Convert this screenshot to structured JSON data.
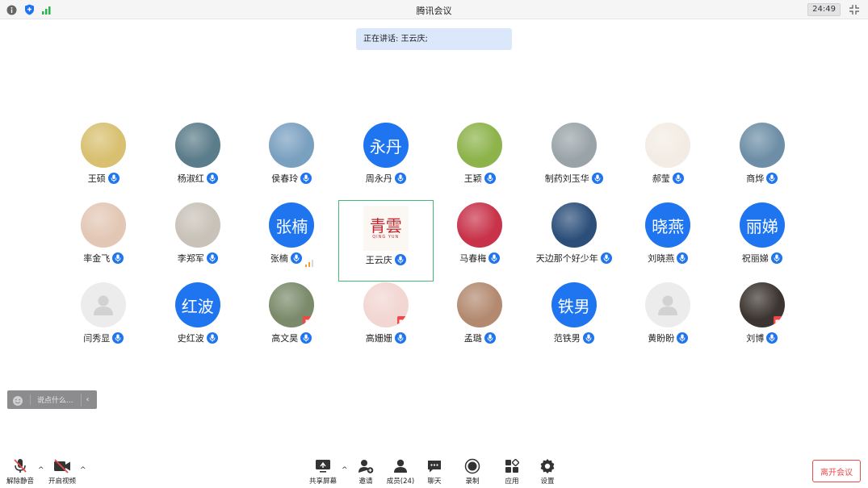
{
  "window": {
    "title": "腾讯会议",
    "timer": "24:49"
  },
  "banner": {
    "speaking": "正在讲话: 王云庆;"
  },
  "participants": [
    {
      "name": "王硕",
      "avatar": "photo",
      "color": "#d8c070"
    },
    {
      "name": "杨淑红",
      "avatar": "photo",
      "color": "#5b7c8a"
    },
    {
      "name": "侯春玲",
      "avatar": "photo",
      "color": "#7aa0c0"
    },
    {
      "name": "周永丹",
      "avatar": "text",
      "text": "永丹"
    },
    {
      "name": "王颖",
      "avatar": "photo",
      "color": "#8db34a"
    },
    {
      "name": "制药刘玉华",
      "avatar": "photo",
      "color": "#9aa4a8"
    },
    {
      "name": "郝莹",
      "avatar": "photo",
      "color": "#f3ece4"
    },
    {
      "name": "商烨",
      "avatar": "photo",
      "color": "#6d8ea6"
    },
    {
      "name": "率金飞",
      "avatar": "photo",
      "color": "#e3c7b5"
    },
    {
      "name": "李郑军",
      "avatar": "photo",
      "color": "#c8c2b8"
    },
    {
      "name": "张楠",
      "avatar": "text",
      "text": "张楠",
      "signal": true
    },
    {
      "name": "王云庆",
      "avatar": "logo",
      "active": true
    },
    {
      "name": "马春梅",
      "avatar": "photo",
      "color": "#c8334a"
    },
    {
      "name": "天边那个好少年",
      "avatar": "photo",
      "color": "#2c4f7a"
    },
    {
      "name": "刘晓燕",
      "avatar": "text",
      "text": "晓燕"
    },
    {
      "name": "祝丽娣",
      "avatar": "text",
      "text": "丽娣"
    },
    {
      "name": "闫秀显",
      "avatar": "default"
    },
    {
      "name": "史红波",
      "avatar": "text",
      "text": "红波"
    },
    {
      "name": "高文昊",
      "avatar": "photo",
      "color": "#7a8a6a",
      "video_off": true
    },
    {
      "name": "高姗姗",
      "avatar": "photo",
      "color": "#f2d6d2",
      "video_off": true
    },
    {
      "name": "孟璐",
      "avatar": "photo",
      "color": "#b38a70"
    },
    {
      "name": "范铁男",
      "avatar": "text",
      "text": "铁男"
    },
    {
      "name": "黄盼盼",
      "avatar": "default",
      "mic_style": "solid"
    },
    {
      "name": "刘博",
      "avatar": "photo",
      "color": "#3b3430",
      "video_off": true
    }
  ],
  "logo_text": {
    "main": "青雲",
    "sub": "QING YUN"
  },
  "chat": {
    "placeholder": "说点什么..."
  },
  "toolbar": {
    "unmute": "解除静音",
    "start_video": "开启视频",
    "share_screen": "共享屏幕",
    "invite": "邀请",
    "members": "成员(24)",
    "chat": "聊天",
    "record": "录制",
    "apps": "应用",
    "settings": "设置",
    "leave": "离开会议"
  },
  "colors": {
    "accent": "#1f74ef",
    "active_border": "#42b873",
    "leave": "#e64c4c",
    "banner": "#dbe8fb"
  }
}
